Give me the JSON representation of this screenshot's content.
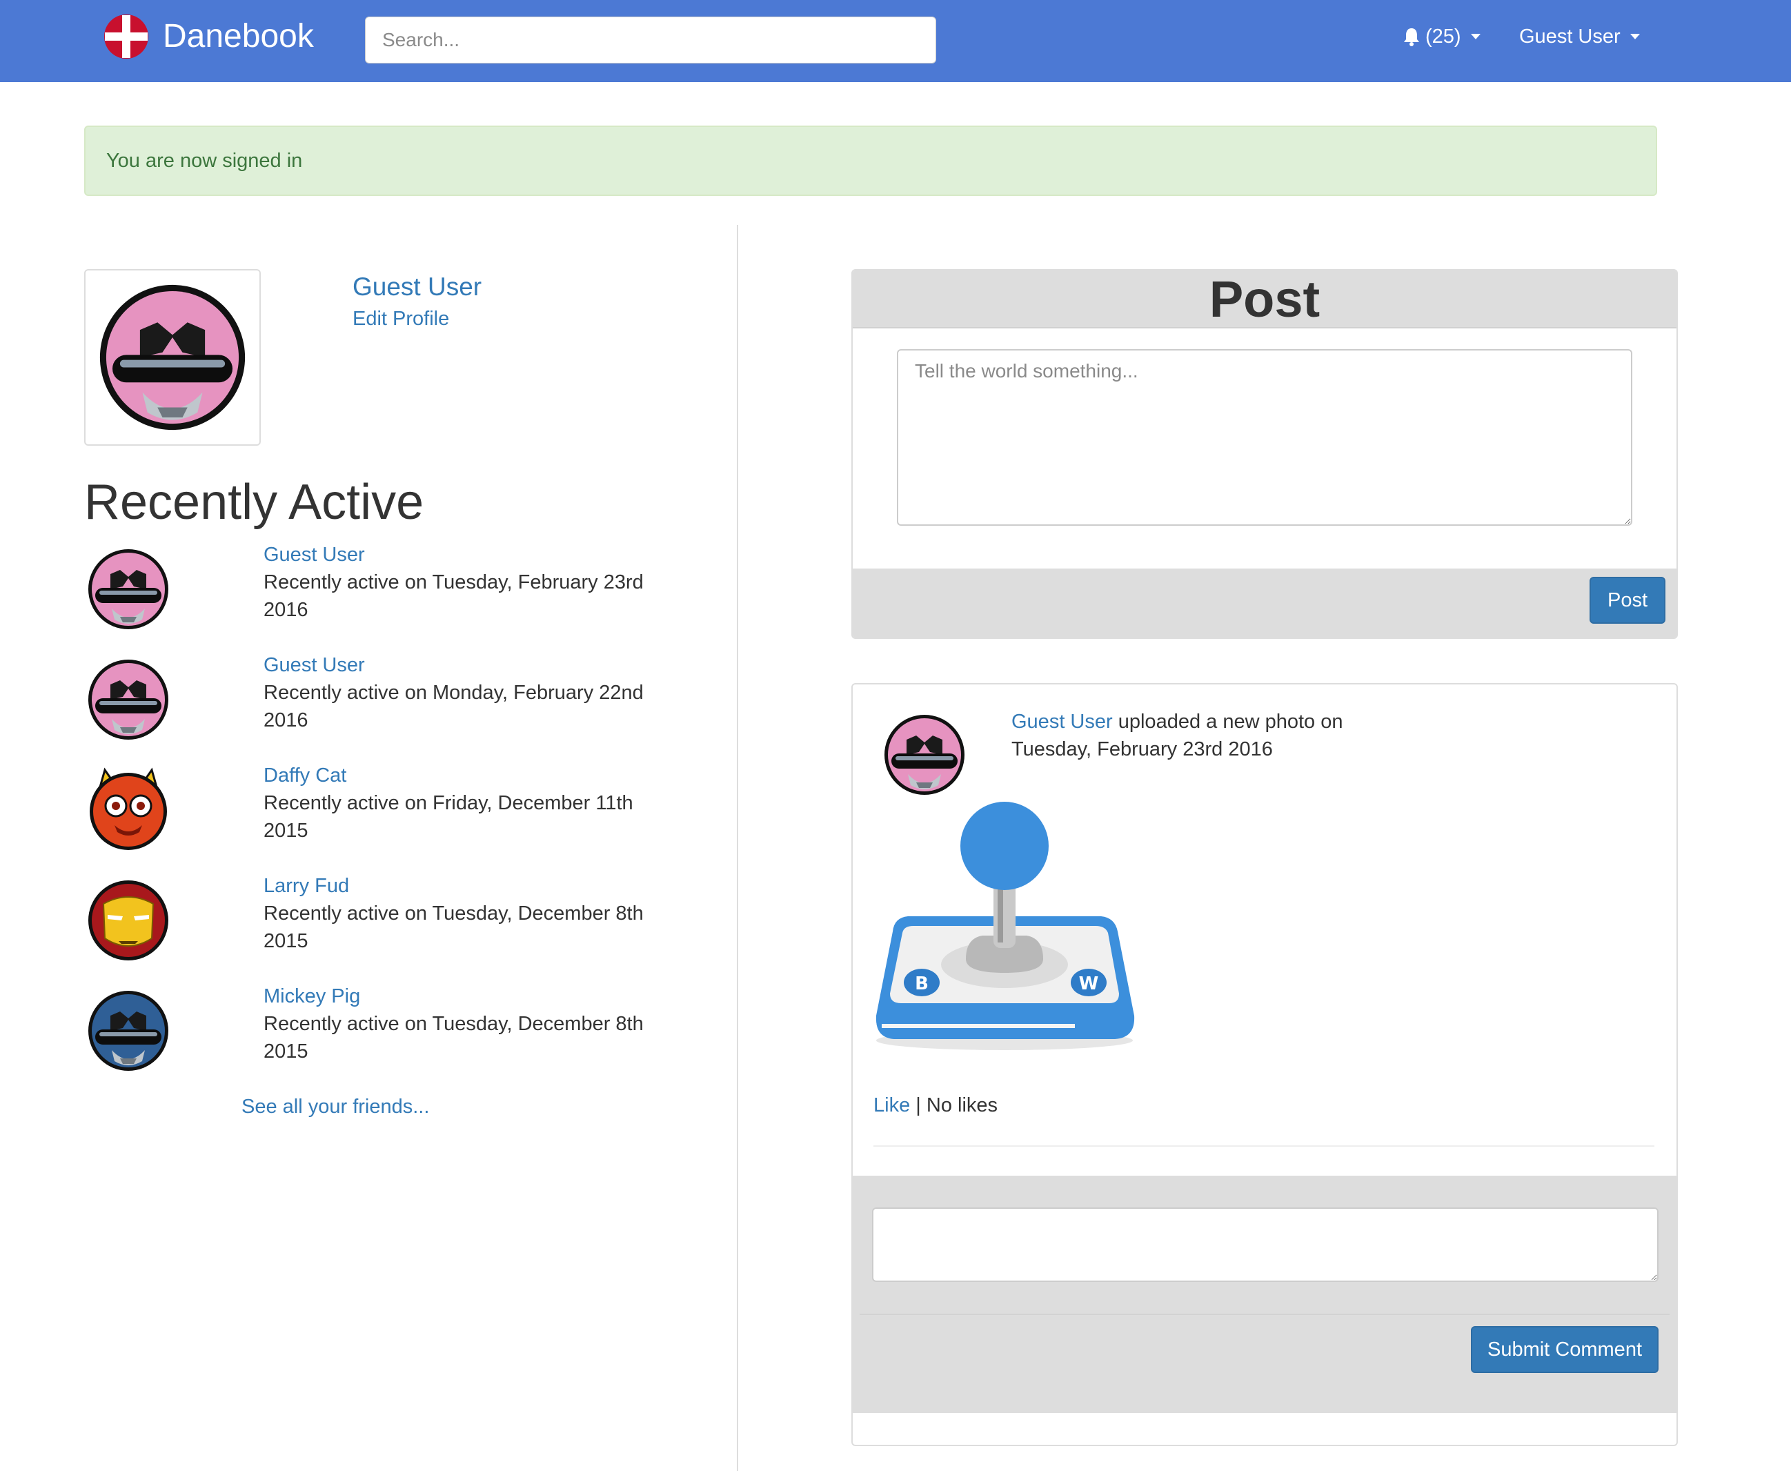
{
  "navbar": {
    "brand": "Danebook",
    "search_placeholder": "Search...",
    "notifications": "(25)",
    "user_menu": "Guest User",
    "accent": "#4c79d4"
  },
  "alert": {
    "message": "You are now signed in",
    "color": "#dff0d8"
  },
  "profile": {
    "name": "Guest User",
    "edit_link": "Edit Profile",
    "avatar": "pink-ranger-avatar"
  },
  "recently_active": {
    "heading": "Recently Active",
    "friends": [
      {
        "name": "Guest User",
        "activity": "Recently active on Tuesday, February 23rd 2016",
        "avatar": "pink-ranger-avatar"
      },
      {
        "name": "Guest User",
        "activity": "Recently active on Monday, February 22nd 2016",
        "avatar": "pink-ranger-avatar"
      },
      {
        "name": "Daffy Cat",
        "activity": "Recently active on Friday, December 11th 2015",
        "avatar": "red-devil-avatar"
      },
      {
        "name": "Larry Fud",
        "activity": "Recently active on Tuesday, December 8th 2015",
        "avatar": "iron-mask-avatar"
      },
      {
        "name": "Mickey Pig",
        "activity": "Recently active on Tuesday, December 8th 2015",
        "avatar": "blue-ranger-avatar"
      }
    ],
    "see_all": "See all your friends..."
  },
  "composer": {
    "title": "Post",
    "placeholder": "Tell the world something...",
    "button": "Post"
  },
  "feed": {
    "author": "Guest User",
    "action": "uploaded a new photo on",
    "date": "Tuesday, February 23rd 2016",
    "photo": "joystick-photo",
    "like_label": "Like",
    "separator": "|",
    "likes_text": "No likes",
    "comment_placeholder": "",
    "submit_label": "Submit Comment"
  }
}
